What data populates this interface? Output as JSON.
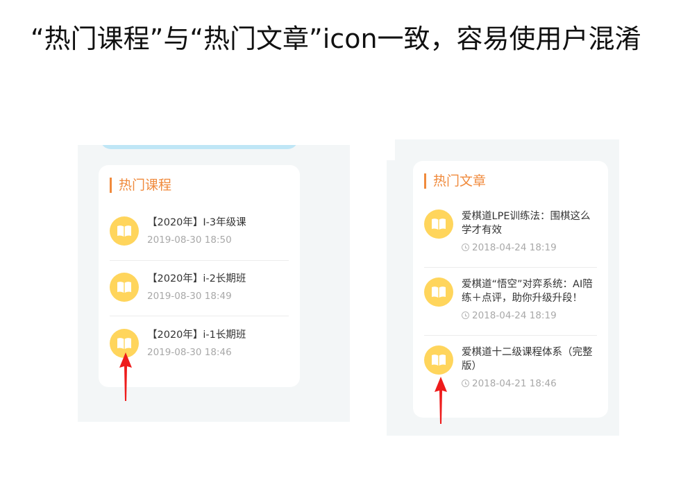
{
  "slide": {
    "headline": "“热门课程”与“热门文章”icon一致，容易使用户混淆"
  },
  "left_panel": {
    "title": "热门课程",
    "items": [
      {
        "title": "【2020年】I-3年级课",
        "date": "2019-08-30 18:50"
      },
      {
        "title": "【2020年】i-2长期班",
        "date": "2019-08-30 18:49"
      },
      {
        "title": "【2020年】i-1长期班",
        "date": "2019-08-30 18:46"
      }
    ]
  },
  "right_panel": {
    "title": "热门文章",
    "items": [
      {
        "title": "爱棋道LPE训练法：围棋这么学才有效",
        "date": "2018-04-24 18:19"
      },
      {
        "title": "爱棋道“悟空”对弈系统：AI陪练＋点评，助你升级升段！",
        "date": "2018-04-24 18:19"
      },
      {
        "title": "爱棋道十二级课程体系（完整版）",
        "date": "2018-04-21 18:46"
      }
    ]
  },
  "colors": {
    "accent": "#f08a3c",
    "icon_bg": "#ffd55c",
    "arrow": "#ee1c1c",
    "panel_bg": "#f3f6f7"
  },
  "icons": {
    "item_icon": "open-book-icon",
    "date_icon": "clock-icon",
    "annotation": "red-arrow-up"
  }
}
